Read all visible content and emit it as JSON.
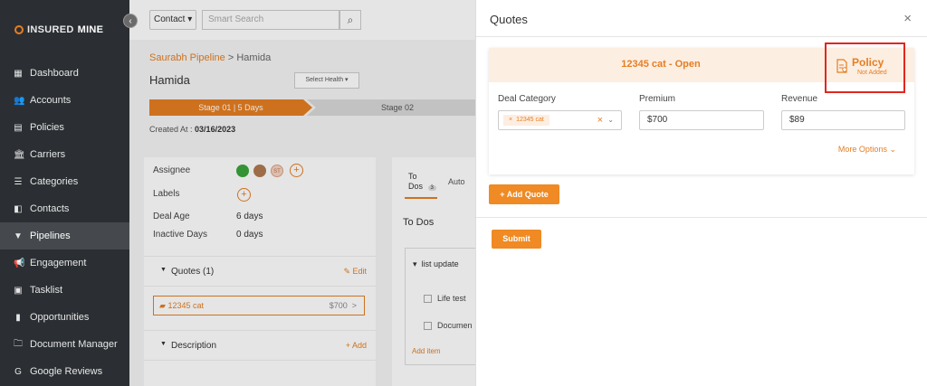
{
  "app": {
    "brand": "INSUREDMINE",
    "brand_bold": "INSURED",
    "brand_light": "MINE",
    "collapse_glyph": "‹"
  },
  "sidebar": {
    "items": [
      {
        "label": "Dashboard",
        "icon": "dashboard-icon",
        "glyph": "▦"
      },
      {
        "label": "Accounts",
        "icon": "accounts-icon",
        "glyph": "👥"
      },
      {
        "label": "Policies",
        "icon": "policies-icon",
        "glyph": "▤"
      },
      {
        "label": "Carriers",
        "icon": "carriers-icon",
        "glyph": "🏛"
      },
      {
        "label": "Categories",
        "icon": "categories-icon",
        "glyph": "☰"
      },
      {
        "label": "Contacts",
        "icon": "contacts-icon",
        "glyph": "◧"
      },
      {
        "label": "Pipelines",
        "icon": "pipelines-icon",
        "glyph": "▼"
      },
      {
        "label": "Engagement",
        "icon": "engagement-icon",
        "glyph": "📢"
      },
      {
        "label": "Tasklist",
        "icon": "tasklist-icon",
        "glyph": "▣"
      },
      {
        "label": "Opportunities",
        "icon": "opportunities-icon",
        "glyph": "▮"
      },
      {
        "label": "Document Manager",
        "icon": "document-manager-icon",
        "glyph": "🗀"
      },
      {
        "label": "Google Reviews",
        "icon": "google-reviews-icon",
        "glyph": "G"
      }
    ],
    "active": "Pipelines"
  },
  "topbar": {
    "contact_select": "Contact ▾",
    "search_placeholder": "Smart Search",
    "search_glyph": "⌕"
  },
  "deal": {
    "breadcrumb_link": "Saurabh Pipeline",
    "breadcrumb_sep": " > ",
    "breadcrumb_current": "Hamida",
    "title": "Hamida",
    "health_select": "Select Health ▾",
    "stage1": "Stage 01 | 5 Days",
    "stage2": "Stage 02",
    "created_label": "Created At :",
    "created_value": "03/16/2023"
  },
  "details": {
    "assignee_label": "Assignee",
    "labels_label": "Labels",
    "deal_age_label": "Deal Age",
    "deal_age_value": "6 days",
    "inactive_label": "Inactive Days",
    "inactive_value": "0 days",
    "avatar_initials": "ST",
    "plus_glyph": "+",
    "caret_glyph": "▼",
    "quotes_section": "Quotes (1)",
    "quotes_edit": "✎ Edit",
    "quote_name": "12345 cat",
    "quote_icon_glyph": "▰",
    "quote_value": "$700",
    "quote_chevron": ">",
    "description_section": "Description",
    "description_add": "+ Add"
  },
  "todos": {
    "tab_todos_line1": "To",
    "tab_todos_line2": "Dos",
    "tab_count": "3",
    "tab_auto": "Auto",
    "title": "To Dos",
    "list_caret": "▾",
    "list_name": "list update",
    "items": [
      "Life test",
      "Documen"
    ],
    "add_item": "Add item"
  },
  "modal": {
    "title": "Quotes",
    "close": "×",
    "quote_header": "12345 cat - Open",
    "policy_label": "Policy",
    "policy_status": "Not Added",
    "deal_category_label": "Deal Category",
    "deal_category_tag": "12345 cat",
    "tag_remove": "×",
    "clear_glyph": "×",
    "caret_glyph": "⌄",
    "premium_label": "Premium",
    "premium_value": "$700",
    "revenue_label": "Revenue",
    "revenue_value": "$89",
    "more_options": "More Options ⌄",
    "add_quote": "+ Add Quote",
    "submit": "Submit"
  },
  "colors": {
    "accent": "#e67e22",
    "sidebar_bg": "#2b2f33",
    "highlight_border": "#e0271f"
  }
}
